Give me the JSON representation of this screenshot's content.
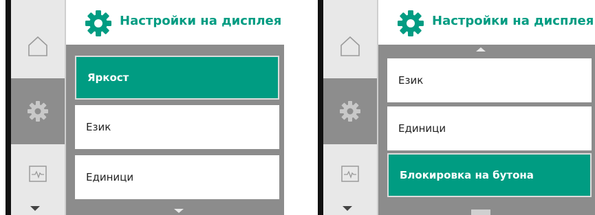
{
  "colors": {
    "accent": "#009c82",
    "rail": "#e8e8e8",
    "rail_active": "#8d8d8d",
    "list_bg": "#8c8c8c"
  },
  "left_screen": {
    "header": {
      "icon": "gear-icon",
      "title": "Настройки на дисплея"
    },
    "rail": [
      "home-icon",
      "gear-icon",
      "pulse-monitor-icon",
      "arrow-down-icon"
    ],
    "items": [
      {
        "label": "Яркост",
        "selected": true
      },
      {
        "label": "Език",
        "selected": false
      },
      {
        "label": "Единици",
        "selected": false
      }
    ]
  },
  "right_screen": {
    "header": {
      "icon": "gear-icon",
      "title": "Настройки на дисплея"
    },
    "rail": [
      "home-icon",
      "gear-icon",
      "pulse-monitor-icon",
      "arrow-down-icon"
    ],
    "items": [
      {
        "label": "Език",
        "selected": false
      },
      {
        "label": "Единици",
        "selected": false
      },
      {
        "label": "Блокировка на бутона",
        "selected": true
      }
    ]
  }
}
